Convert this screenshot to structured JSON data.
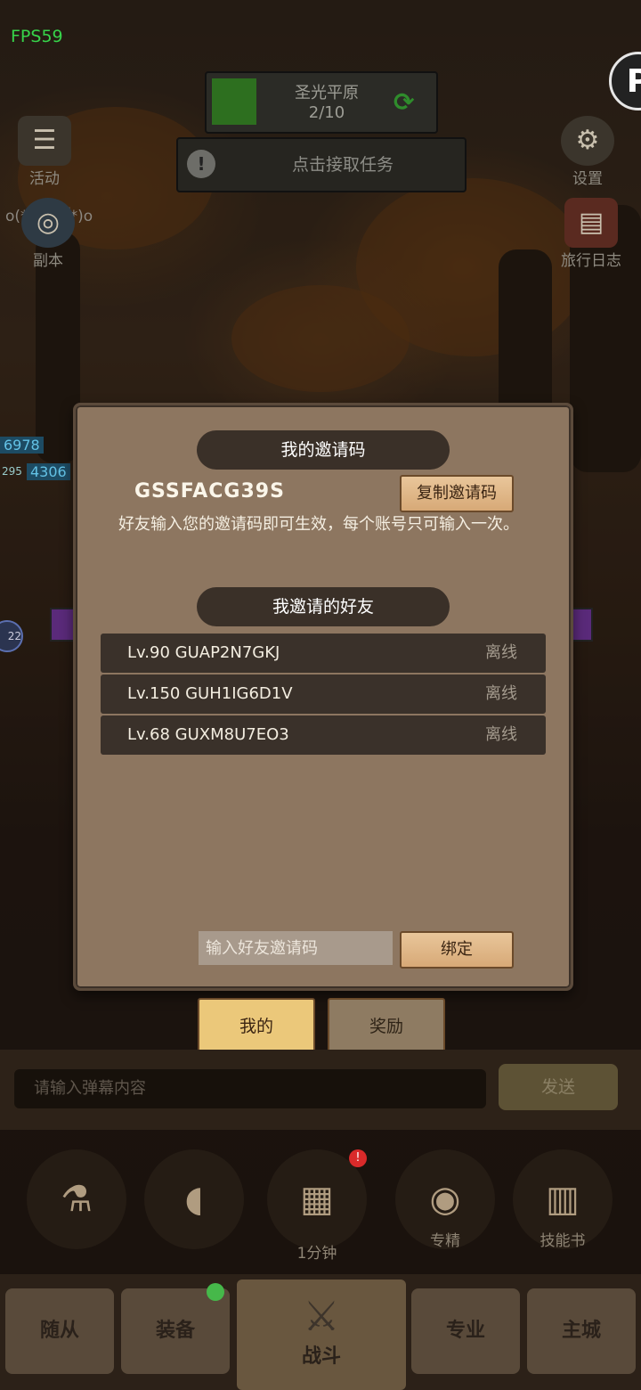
{
  "hud": {
    "fps": "FPS59",
    "logo": "P",
    "stage": {
      "name": "圣光平原",
      "progress": "2/10"
    },
    "task": "点击接取任务",
    "left_buttons": {
      "activity": "活动",
      "dungeon": "副本"
    },
    "right_buttons": {
      "settings": "设置",
      "journal": "旅行日志"
    },
    "emote": "o(*￣▽￣*)o",
    "hp": {
      "a": "6978",
      "b": "4306",
      "level": "295",
      "side": "22"
    }
  },
  "dialog": {
    "title": "我的邀请码",
    "code": "GSSFACG39S",
    "copy_label": "复制邀请码",
    "description": "好友输入您的邀请码即可生效，每个账号只可输入一次。",
    "friends_title": "我邀请的好友",
    "friends": [
      {
        "name": "Lv.90 GUAP2N7GKJ",
        "status": "离线"
      },
      {
        "name": "Lv.150 GUH1IG6D1V",
        "status": "离线"
      },
      {
        "name": "Lv.68 GUXM8U7EO3",
        "status": "离线"
      }
    ],
    "bind_placeholder": "输入好友邀请码",
    "bind_label": "绑定"
  },
  "tabs": {
    "mine": "我的",
    "reward": "奖励"
  },
  "chat": {
    "placeholder": "请输入弹幕内容",
    "send": "发送"
  },
  "quick": {
    "chest_time": "1分钟",
    "refine": "专精",
    "skillbook": "技能书"
  },
  "nav": {
    "followers": "随从",
    "equipment": "装备",
    "battle": "战斗",
    "profession": "专业",
    "city": "主城"
  }
}
